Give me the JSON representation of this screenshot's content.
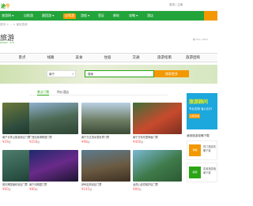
{
  "topbar": {
    "logo_a": "途",
    "logo_b": "牛",
    "right_text": "登录 | 注册"
  },
  "nav": {
    "items": [
      {
        "label": "旅游网 ▾",
        "badge": false
      },
      {
        "label": "自助游",
        "badge": false
      },
      {
        "label": "跟团游 ▾",
        "badge": false
      },
      {
        "label": "自驾游",
        "badge": true
      },
      {
        "label": "游船 ▾",
        "badge": false
      },
      {
        "label": "签证",
        "badge": false
      },
      {
        "label": "邮轮",
        "badge": false
      },
      {
        "label": "攻略 ▾",
        "badge": false
      },
      {
        "label": "酒店",
        "badge": false
      }
    ]
  },
  "breadcrumb": "首页 > ... > 景区旅游",
  "city": {
    "name": "旅游",
    "en": "LVYOU · 2°C"
  },
  "weather": "晴 5°C~15°C",
  "tabs": [
    "景点",
    "线路",
    "美食",
    "住宿",
    "交通",
    "旅游指南",
    "旅游团购",
    "旅游问答"
  ],
  "search": {
    "city": "南宁",
    "placeholder": "搜索",
    "button": "搜索更多"
  },
  "subtabs": [
    "景点门票",
    "特价酒店"
  ],
  "cards": [
    {
      "name": "南宁青秀山旅游景区门票",
      "price": "¥29",
      "unit": "起"
    },
    {
      "name": "广西民族博物馆门票",
      "price": "¥258",
      "unit": "起"
    },
    {
      "name": "南宁万达茂冰雪世界门票",
      "price": "¥98",
      "unit": "起"
    },
    {
      "name": "南宁方特东盟神画门票",
      "price": "¥400",
      "unit": "起"
    },
    {
      "name": "德天跨国瀑布景区门票",
      "price": "¥60",
      "unit": "起"
    },
    {
      "name": "南宁动物园门票",
      "price": "¥80",
      "unit": "起"
    },
    {
      "name": "伊岭岩风景区门票",
      "price": "¥145",
      "unit": "起"
    },
    {
      "name": "龙虎山自然保护区门票",
      "price": "¥80",
      "unit": "起"
    }
  ],
  "ad": {
    "t1": "旅游顾问",
    "t2": "专业定制 省心出行",
    "t3": "立即咨询"
  },
  "side": {
    "heading": "我到旅游攻略下载",
    "items": [
      {
        "icon": "攻略",
        "label": "热门旅游攻略下载"
      },
      {
        "icon": "指南",
        "label": "实用旅游指南下载"
      }
    ]
  },
  "colors": {
    "brand": "#22a43a",
    "accent": "#f39800",
    "price": "#f55"
  }
}
